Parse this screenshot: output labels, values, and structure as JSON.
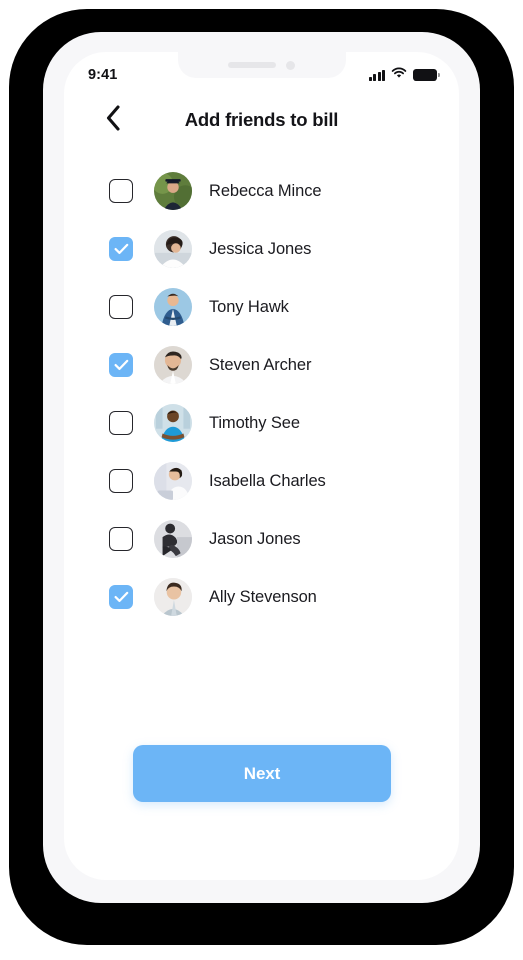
{
  "statusbar": {
    "time": "9:41",
    "signal_icon": "cellular-signal-icon",
    "wifi_icon": "wifi-icon",
    "battery_icon": "battery-full-icon"
  },
  "navbar": {
    "back_icon": "chevron-left-icon",
    "title": "Add friends to bill"
  },
  "friends": [
    {
      "name": "Rebecca Mince",
      "checked": false,
      "avatar": "graduate-portrait"
    },
    {
      "name": "Jessica Jones",
      "checked": true,
      "avatar": "woman-white-top-portrait"
    },
    {
      "name": "Tony Hawk",
      "checked": false,
      "avatar": "man-blue-blazer-portrait"
    },
    {
      "name": "Steven Archer",
      "checked": true,
      "avatar": "bearded-man-white-shirt-portrait"
    },
    {
      "name": "Timothy See",
      "checked": false,
      "avatar": "man-blue-polo-portrait"
    },
    {
      "name": "Isabella Charles",
      "checked": false,
      "avatar": "woman-at-desk-portrait"
    },
    {
      "name": "Jason Jones",
      "checked": false,
      "avatar": "seated-person-dark-clothes-portrait"
    },
    {
      "name": "Ally Stevenson",
      "checked": true,
      "avatar": "short-hair-light-sweater-portrait"
    }
  ],
  "footer": {
    "next_label": "Next"
  },
  "colors": {
    "accent": "#6cb5f6",
    "text": "#1b1b20",
    "screen_bg": "#ffffff",
    "bezel": "#000000",
    "phone_body": "#f7f7f9"
  }
}
